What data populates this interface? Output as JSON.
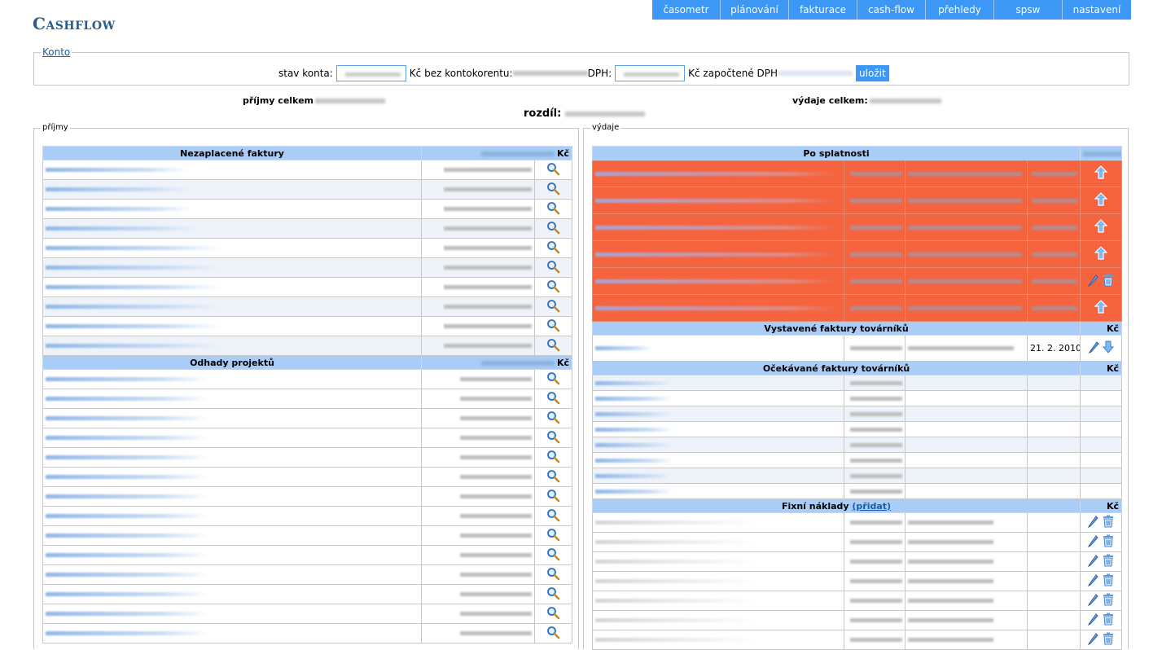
{
  "app": {
    "title": "Cashflow"
  },
  "nav": [
    "časometr",
    "plánování",
    "fakturace",
    "cash-flow",
    "přehledy",
    "spsw",
    "nastavení"
  ],
  "konto": {
    "legend": "Konto",
    "stav_label": "stav konta:",
    "kc_bez_label": "Kč bez kontokorentu:",
    "dph_label": "DPH:",
    "kc_zapoctene_label": "Kč započtené DPH",
    "save_label": "uložit"
  },
  "summary": {
    "prijmy_label": "příjmy celkem",
    "vydaje_label": "výdaje celkem:",
    "rozdil_label": "rozdíl:"
  },
  "prijmy": {
    "legend": "příjmy",
    "nezaplacene": {
      "title": "Nezaplacené faktury",
      "currency": "Kč",
      "rows": 10
    },
    "odhady": {
      "title": "Odhady projektů",
      "currency": "Kč",
      "rows": 14
    }
  },
  "vydaje": {
    "legend": "výdaje",
    "po_splatnosti": {
      "title": "Po splatnosti"
    },
    "vystavene": {
      "title": "Vystavené faktury továrníků",
      "currency": "Kč",
      "date": "21. 2. 2010"
    },
    "ocekavane": {
      "title": "Očekávané faktury továrníků",
      "currency": "Kč"
    },
    "fixni": {
      "title": "Fixní náklady",
      "add_label": "(přidat)",
      "currency": "Kč"
    }
  },
  "icons": {
    "search": "magnifier-icon",
    "up": "arrow-up-icon",
    "down": "arrow-down-icon",
    "edit": "pencil-icon",
    "delete": "trash-icon"
  },
  "colors": {
    "accent": "#3c97f5",
    "header": "#a9cdf6",
    "overdue": "#f5643f",
    "brand": "#2a5d8c"
  }
}
